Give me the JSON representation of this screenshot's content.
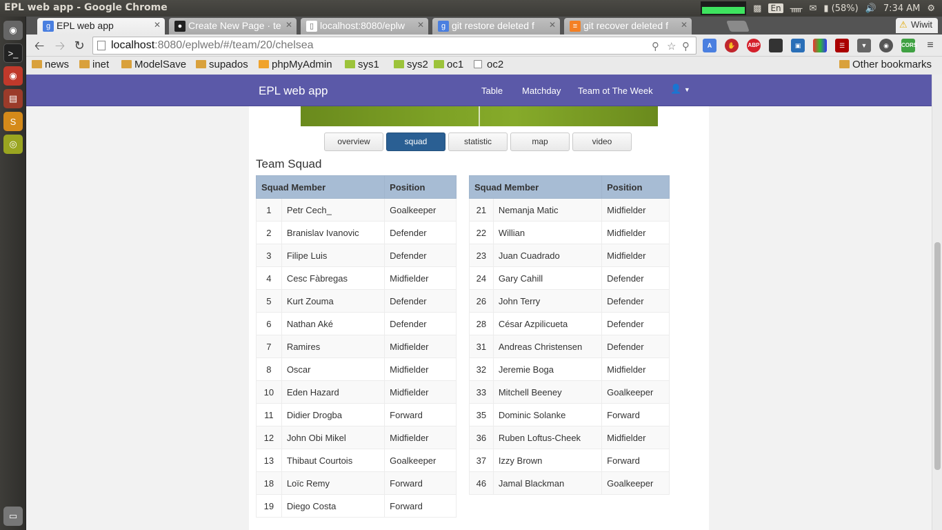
{
  "os": {
    "window_title": "EPL web app - Google Chrome",
    "indicators": {
      "lang": "En",
      "battery": "(58%)",
      "time": "7:34 AM"
    }
  },
  "browser": {
    "tabs": [
      {
        "title": "EPL web app",
        "icon": "google-icon",
        "active": true
      },
      {
        "title": "Create New Page · te",
        "icon": "github-icon",
        "active": false
      },
      {
        "title": "localhost:8080/eplw",
        "icon": "page-icon",
        "active": false
      },
      {
        "title": "git restore deleted f",
        "icon": "google-icon",
        "active": false
      },
      {
        "title": "git recover deleted f",
        "icon": "stackoverflow-icon",
        "active": false
      }
    ],
    "extra_tab": "Wiwit",
    "url_host": "localhost",
    "url_rest": ":8080/eplweb/#/team/20/chelsea",
    "bookmarks": [
      {
        "label": "news",
        "icon": "folder-icon"
      },
      {
        "label": "inet",
        "icon": "folder-icon"
      },
      {
        "label": "ModelSave",
        "icon": "folder-icon"
      },
      {
        "label": "supados",
        "icon": "folder-icon"
      },
      {
        "label": "phpMyAdmin",
        "icon": "phpmyadmin-icon"
      },
      {
        "label": "sys1",
        "icon": "leaf-icon"
      },
      {
        "label": "sys2",
        "icon": "leaf-icon"
      },
      {
        "label": "oc1",
        "icon": "leaf-icon"
      },
      {
        "label": "oc2",
        "icon": "page-icon"
      }
    ],
    "other_bookmarks": "Other bookmarks",
    "extensions": [
      "translate",
      "stop",
      "ABP",
      "dark",
      "screen",
      "colors",
      "reader",
      "shield",
      "globe",
      "CORS"
    ]
  },
  "app": {
    "brand": "EPL web app",
    "nav": {
      "table": "Table",
      "matchday": "Matchday",
      "totw": "Team ot The Week"
    },
    "tabs": [
      "overview",
      "squad",
      "statistic",
      "map",
      "video"
    ],
    "active_tab": "squad",
    "section_title": "Team Squad",
    "headers": {
      "member": "Squad Member",
      "position": "Position"
    },
    "squad_left": [
      {
        "no": "1",
        "name": "Petr Cech_",
        "pos": "Goalkeeper"
      },
      {
        "no": "2",
        "name": "Branislav Ivanovic",
        "pos": "Defender"
      },
      {
        "no": "3",
        "name": "Filipe Luis",
        "pos": "Defender"
      },
      {
        "no": "4",
        "name": "Cesc Fàbregas",
        "pos": "Midfielder"
      },
      {
        "no": "5",
        "name": "Kurt Zouma",
        "pos": "Defender"
      },
      {
        "no": "6",
        "name": "Nathan Aké",
        "pos": "Defender"
      },
      {
        "no": "7",
        "name": "Ramires",
        "pos": "Midfielder"
      },
      {
        "no": "8",
        "name": "Oscar",
        "pos": "Midfielder"
      },
      {
        "no": "10",
        "name": "Eden Hazard",
        "pos": "Midfielder"
      },
      {
        "no": "11",
        "name": "Didier Drogba",
        "pos": "Forward"
      },
      {
        "no": "12",
        "name": "John Obi Mikel",
        "pos": "Midfielder"
      },
      {
        "no": "13",
        "name": "Thibaut Courtois",
        "pos": "Goalkeeper"
      },
      {
        "no": "18",
        "name": "Loïc Remy",
        "pos": "Forward"
      },
      {
        "no": "19",
        "name": "Diego Costa",
        "pos": "Forward"
      }
    ],
    "squad_right": [
      {
        "no": "21",
        "name": "Nemanja Matic",
        "pos": "Midfielder"
      },
      {
        "no": "22",
        "name": "Willian",
        "pos": "Midfielder"
      },
      {
        "no": "23",
        "name": "Juan Cuadrado",
        "pos": "Midfielder"
      },
      {
        "no": "24",
        "name": "Gary Cahill",
        "pos": "Defender"
      },
      {
        "no": "26",
        "name": "John Terry",
        "pos": "Defender"
      },
      {
        "no": "28",
        "name": "César Azpilicueta",
        "pos": "Defender"
      },
      {
        "no": "31",
        "name": "Andreas Christensen",
        "pos": "Defender"
      },
      {
        "no": "32",
        "name": "Jeremie Boga",
        "pos": "Midfielder"
      },
      {
        "no": "33",
        "name": "Mitchell Beeney",
        "pos": "Goalkeeper"
      },
      {
        "no": "35",
        "name": "Dominic Solanke",
        "pos": "Forward"
      },
      {
        "no": "36",
        "name": "Ruben Loftus-Cheek",
        "pos": "Midfielder"
      },
      {
        "no": "37",
        "name": "Izzy Brown",
        "pos": "Forward"
      },
      {
        "no": "46",
        "name": "Jamal Blackman",
        "pos": "Goalkeeper"
      }
    ]
  },
  "colors": {
    "navbar": "#5b59a8",
    "active_tab": "#2a5f93",
    "table_header": "#a7bcd4"
  }
}
